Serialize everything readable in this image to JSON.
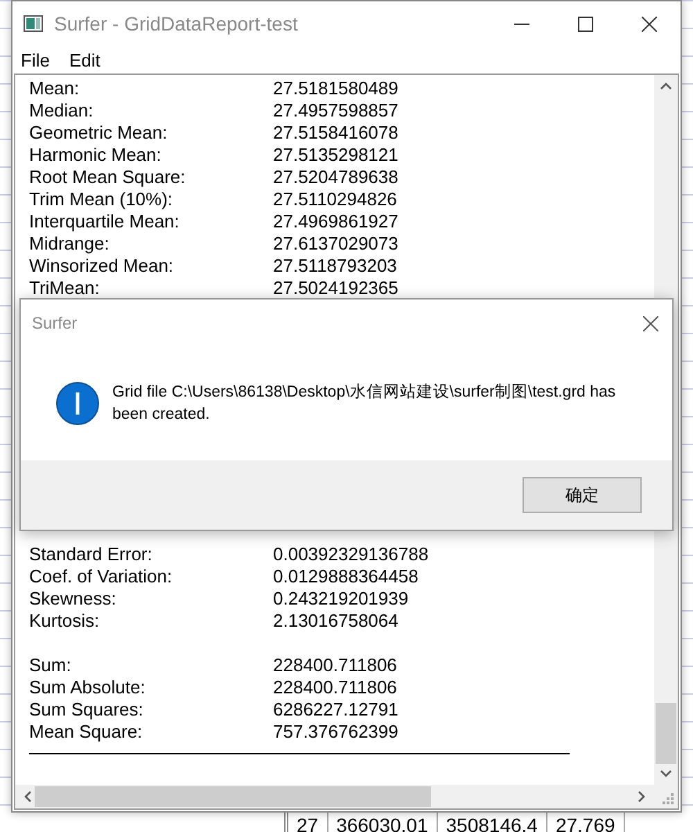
{
  "window": {
    "title": "Surfer - GridDataReport-test"
  },
  "menu": [
    {
      "label": "File"
    },
    {
      "label": "Edit"
    }
  ],
  "report": {
    "groups": [
      {
        "rows": [
          {
            "label": "Mean:",
            "value": "27.5181580489"
          },
          {
            "label": "Median:",
            "value": "27.4957598857"
          },
          {
            "label": "Geometric Mean:",
            "value": "27.5158416078"
          },
          {
            "label": "Harmonic Mean:",
            "value": "27.5135298121"
          },
          {
            "label": "Root Mean Square:",
            "value": "27.5204789638"
          },
          {
            "label": "Trim Mean (10%):",
            "value": "27.5110294826"
          },
          {
            "label": "Interquartile Mean:",
            "value": "27.4969861927"
          },
          {
            "label": "Midrange:",
            "value": "27.6137029073"
          },
          {
            "label": "Winsorized Mean:",
            "value": "27.5118793203"
          },
          {
            "label": "TriMean:",
            "value": "27.5024192365"
          }
        ]
      },
      {
        "rows": [
          {
            "label": "Standard Error:",
            "value": "0.00392329136788"
          },
          {
            "label": "Coef. of Variation:",
            "value": "0.0129888364458"
          },
          {
            "label": "Skewness:",
            "value": "0.243219201939"
          },
          {
            "label": "Kurtosis:",
            "value": "2.13016758064"
          }
        ]
      },
      {
        "rows": [
          {
            "label": "Sum:",
            "value": "228400.711806"
          },
          {
            "label": "Sum Absolute:",
            "value": "228400.711806"
          },
          {
            "label": "Sum Squares:",
            "value": "6286227.12791"
          },
          {
            "label": "Mean Square:",
            "value": "757.376762399"
          }
        ]
      }
    ]
  },
  "dialog": {
    "title": "Surfer",
    "message": "Grid file C:\\Users\\86138\\Desktop\\水信网站建设\\surfer制图\\test.grd has been created.",
    "button": "确定"
  },
  "background_sheet": {
    "cells": [
      "27",
      "366030.01",
      "3508146.4",
      "27.769"
    ]
  }
}
